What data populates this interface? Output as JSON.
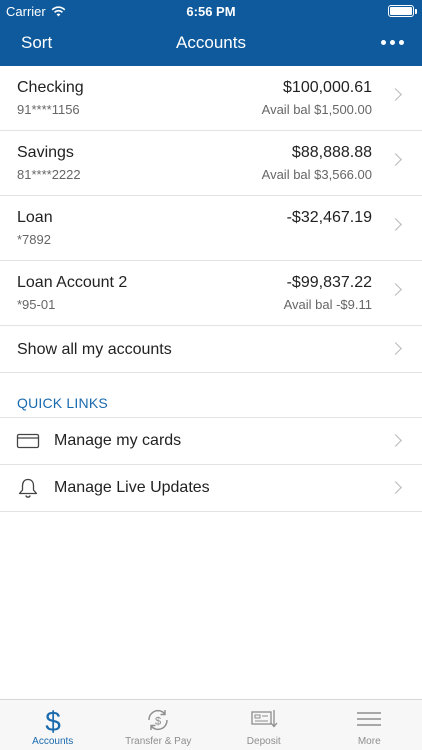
{
  "status_bar": {
    "carrier": "Carrier",
    "time": "6:56 PM"
  },
  "nav": {
    "left": "Sort",
    "title": "Accounts",
    "more_icon": "ellipsis-icon"
  },
  "accounts": [
    {
      "name": "Checking",
      "number": "91****1156",
      "balance": "$100,000.61",
      "available": "Avail bal $1,500.00"
    },
    {
      "name": "Savings",
      "number": "81****2222",
      "balance": "$88,888.88",
      "available": "Avail bal $3,566.00"
    },
    {
      "name": "Loan",
      "number": "*7892",
      "balance": "-$32,467.19",
      "available": ""
    },
    {
      "name": "Loan Account 2",
      "number": "*95-01",
      "balance": "-$99,837.22",
      "available": "Avail bal -$9.11"
    }
  ],
  "show_all": "Show all my accounts",
  "quick_links": {
    "title": "QUICK LINKS",
    "items": [
      {
        "label": "Manage my cards",
        "icon": "card-icon"
      },
      {
        "label": "Manage Live Updates",
        "icon": "bell-icon"
      }
    ]
  },
  "tabs": [
    {
      "label": "Accounts",
      "icon": "dollar-icon",
      "active": true
    },
    {
      "label": "Transfer & Pay",
      "icon": "transfer-icon",
      "active": false
    },
    {
      "label": "Deposit",
      "icon": "deposit-check-icon",
      "active": false
    },
    {
      "label": "More",
      "icon": "menu-icon",
      "active": false
    }
  ],
  "colors": {
    "brand": "#0e5a9c",
    "accent": "#1a6aae",
    "text": "#222222",
    "muted": "#666666",
    "divider": "#e3e3e3"
  }
}
